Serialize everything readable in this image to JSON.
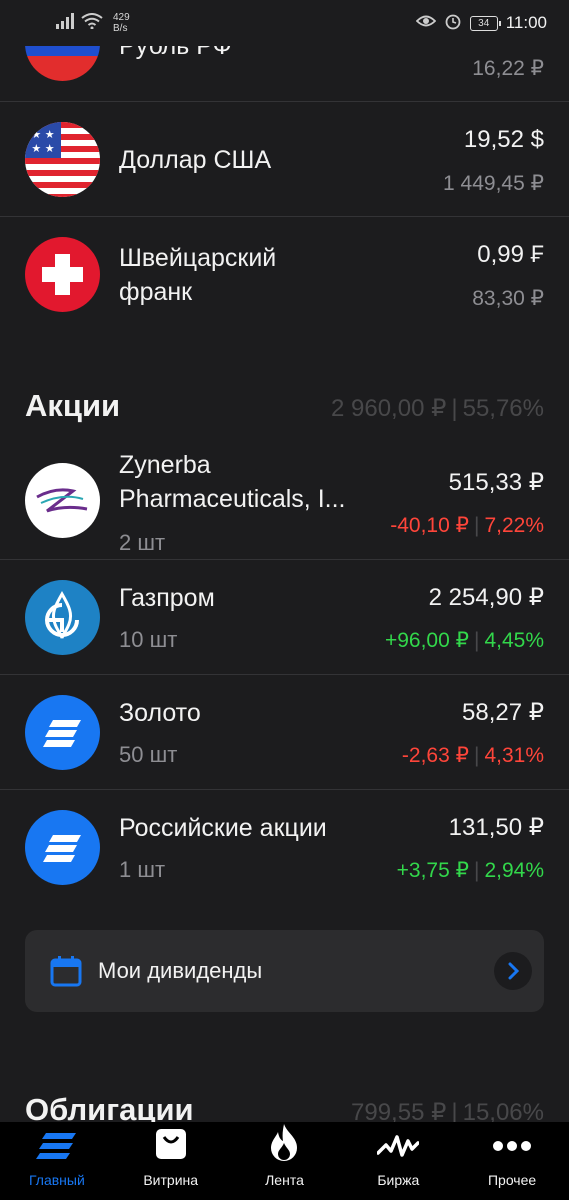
{
  "status_bar": {
    "speed_value": "429",
    "speed_unit": "B/s",
    "battery": "34",
    "time": "11:00"
  },
  "rub_row": {
    "name": "Рубль РФ",
    "value": "16,22 ₽"
  },
  "usd_row": {
    "name": "Доллар США",
    "value": "19,52 $",
    "value_rub": "1 449,45 ₽"
  },
  "chf_row": {
    "name_line1": "Швейцарский",
    "name_line2": "франк",
    "value": "0,99 ₣",
    "value_rub": "83,30 ₽"
  },
  "stocks_section": {
    "title": "Акции",
    "total": "2 960,00 ₽",
    "share": "55,76%"
  },
  "stocks": [
    {
      "name_line1": "Zynerba",
      "name_line2": "Pharmaceuticals, I...",
      "qty": "2 шт",
      "price": "515,33 ₽",
      "change_abs": "-40,10 ₽",
      "change_pct": "7,22%",
      "direction": "down"
    },
    {
      "name": "Газпром",
      "qty": "10 шт",
      "price": "2 254,90 ₽",
      "change_abs": "+96,00 ₽",
      "change_pct": "4,45%",
      "direction": "up"
    },
    {
      "name": "Золото",
      "qty": "50 шт",
      "price": "58,27 ₽",
      "change_abs": "-2,63 ₽",
      "change_pct": "4,31%",
      "direction": "down"
    },
    {
      "name": "Российские акции",
      "qty": "1 шт",
      "price": "131,50 ₽",
      "change_abs": "+3,75 ₽",
      "change_pct": "2,94%",
      "direction": "up"
    }
  ],
  "dividends_card": {
    "label": "Мои дивиденды"
  },
  "bonds_section": {
    "title": "Облигации",
    "total": "799,55 ₽",
    "share": "15,06%"
  },
  "tabbar": [
    {
      "label": "Главный",
      "icon": "home-stripes-icon",
      "active": true
    },
    {
      "label": "Витрина",
      "icon": "shopping-bag-icon",
      "active": false
    },
    {
      "label": "Лента",
      "icon": "flame-icon",
      "active": false
    },
    {
      "label": "Биржа",
      "icon": "pulse-chart-icon",
      "active": false
    },
    {
      "label": "Прочее",
      "icon": "more-dots-icon",
      "active": false
    }
  ],
  "colors": {
    "background": "#1c1c1e",
    "accent": "#1877f2",
    "negative": "#ff453a",
    "positive": "#32d74b",
    "muted": "#8e8e93"
  }
}
